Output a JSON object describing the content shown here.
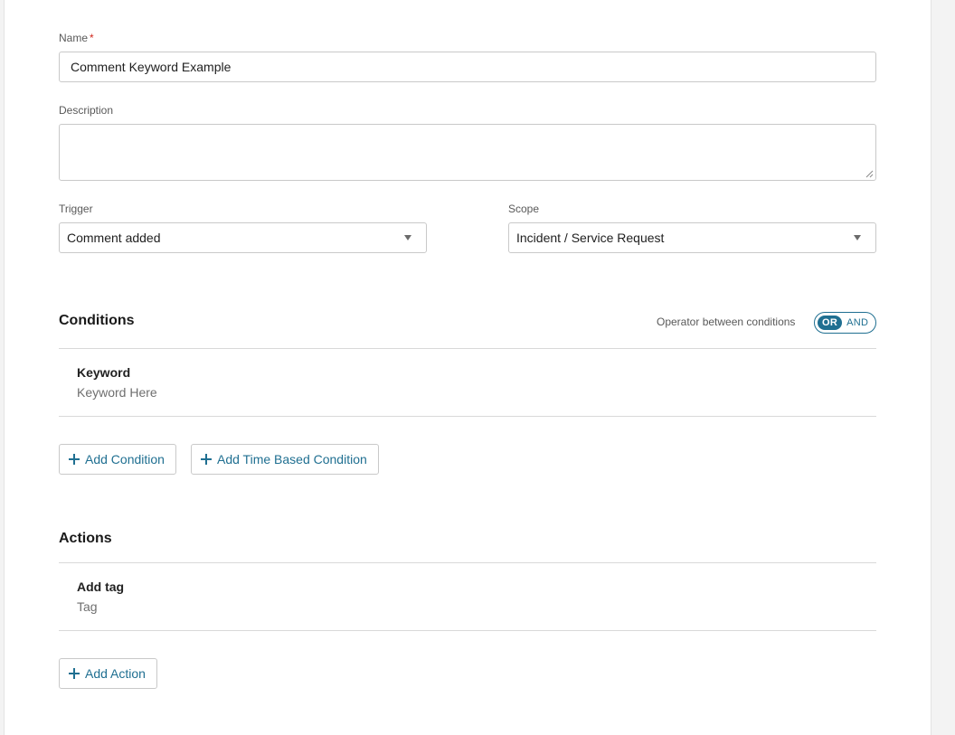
{
  "form": {
    "name_label": "Name",
    "name_required_mark": "*",
    "name_value": "Comment Keyword Example",
    "description_label": "Description",
    "description_value": "",
    "trigger_label": "Trigger",
    "trigger_value": "Comment added",
    "scope_label": "Scope",
    "scope_value": "Incident / Service Request"
  },
  "conditions": {
    "title": "Conditions",
    "operator_label": "Operator between conditions",
    "operator_options": [
      "OR",
      "AND"
    ],
    "operator_selected": "OR",
    "items": [
      {
        "title": "Keyword",
        "value": "Keyword Here"
      }
    ],
    "add_condition_label": "Add Condition",
    "add_time_condition_label": "Add Time Based Condition"
  },
  "actions": {
    "title": "Actions",
    "items": [
      {
        "title": "Add tag",
        "value": "Tag"
      }
    ],
    "add_action_label": "Add Action"
  },
  "colors": {
    "accent": "#1f6f91",
    "required": "#d0271d",
    "border": "#c9c9c9"
  },
  "icons": {
    "dropdown": "caret-down-icon",
    "add": "plus-icon"
  }
}
